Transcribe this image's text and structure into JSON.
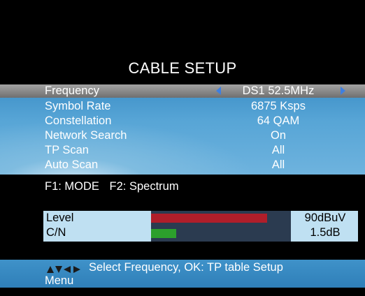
{
  "title": "CABLE SETUP",
  "menu": {
    "rows": [
      {
        "label": "Frequency",
        "value": "DS1  52.5MHz",
        "selected": true
      },
      {
        "label": "Symbol Rate",
        "value": "6875 Ksps"
      },
      {
        "label": "Constellation",
        "value": "64 QAM"
      },
      {
        "label": "Network Search",
        "value": "On"
      },
      {
        "label": "TP Scan",
        "value": "All"
      },
      {
        "label": "Auto Scan",
        "value": "All"
      }
    ]
  },
  "function_keys": {
    "f1": "F1: MODE",
    "f2": "F2: Spectrum"
  },
  "meters": {
    "level": {
      "label": "Level",
      "value": "90dBuV",
      "fill": 0.83,
      "color": "#b01e2a"
    },
    "cn": {
      "label": "C/N",
      "value": "1.5dB",
      "fill": 0.18,
      "color": "#2ca02c"
    }
  },
  "status_bar": {
    "hint": "Select Frequency, OK: TP table Setup",
    "menu_label": "Menu",
    "icons": [
      "up-arrow-icon",
      "down-arrow-icon",
      "left-arrow-icon",
      "right-arrow-icon"
    ]
  },
  "colors": {
    "selected_row": "#8a8a8a",
    "menu_bg": "#57a5d6",
    "arrow": "#3f7fe0",
    "status_bg": "#2f7fb8"
  }
}
